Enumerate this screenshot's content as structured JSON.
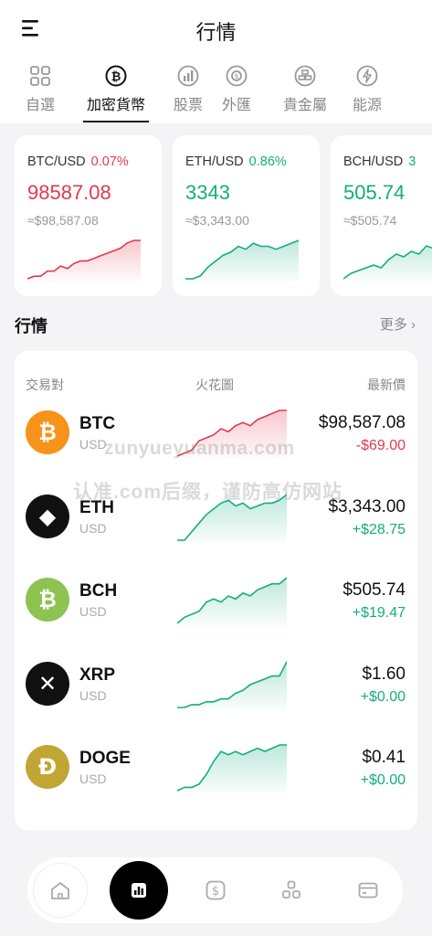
{
  "header": {
    "title": "行情"
  },
  "tabs": [
    {
      "label": "自選",
      "icon": "grid-icon",
      "active": false
    },
    {
      "label": "加密貨幣",
      "icon": "bitcoin-icon",
      "active": true
    },
    {
      "label": "股票",
      "icon": "stock-chart-icon",
      "active": false
    },
    {
      "label": "外匯",
      "icon": "exchange-icon",
      "active": false
    },
    {
      "label": "貴金屬",
      "icon": "gold-icon",
      "active": false
    },
    {
      "label": "能源",
      "icon": "energy-icon",
      "active": false
    }
  ],
  "featured": [
    {
      "pair": "BTC/USD",
      "change_pct": "0.07%",
      "price": "98587.08",
      "approx": "≈$98,587.08",
      "trend": "up-red",
      "sparkline": [
        2,
        3,
        3,
        5,
        5,
        7,
        6,
        8,
        9,
        9,
        10,
        11,
        12,
        13,
        14,
        16,
        17,
        17
      ]
    },
    {
      "pair": "ETH/USD",
      "change_pct": "0.86%",
      "price": "3343",
      "approx": "≈$3,343.00",
      "trend": "up-green",
      "sparkline": [
        1,
        1,
        2,
        5,
        7,
        9,
        10,
        12,
        11,
        13,
        12,
        12,
        11,
        12,
        13,
        14
      ]
    },
    {
      "pair": "BCH/USD",
      "change_pct": "3",
      "price": "505.74",
      "approx": "≈$505.74",
      "trend": "up-green",
      "sparkline": [
        1,
        3,
        4,
        5,
        6,
        5,
        8,
        10,
        9,
        11,
        10,
        13,
        12,
        14,
        14,
        15
      ]
    }
  ],
  "section": {
    "title": "行情",
    "more_label": "更多"
  },
  "table_headers": {
    "pair": "交易對",
    "chart": "火花圖",
    "latest": "最新價"
  },
  "rows": [
    {
      "symbol": "BTC",
      "quote": "USD",
      "price": "$98,587.08",
      "change": "-$69.00",
      "direction": "down",
      "logo_color": "#f7931a",
      "logo_text": "₿",
      "sparkline": [
        2,
        3,
        4,
        7,
        8,
        9,
        11,
        10,
        12,
        13,
        12,
        14,
        15,
        16,
        17,
        17
      ]
    },
    {
      "symbol": "ETH",
      "quote": "USD",
      "price": "$3,343.00",
      "change": "+$28.75",
      "direction": "up",
      "logo_color": "#111111",
      "logo_text": "◆",
      "sparkline": [
        1,
        1,
        4,
        7,
        10,
        12,
        14,
        15,
        13,
        14,
        12,
        13,
        14,
        14,
        15,
        17
      ]
    },
    {
      "symbol": "BCH",
      "quote": "USD",
      "price": "$505.74",
      "change": "+$19.47",
      "direction": "up",
      "logo_color": "#8dc351",
      "logo_text": "₿",
      "sparkline": [
        2,
        4,
        5,
        6,
        9,
        10,
        9,
        11,
        10,
        12,
        11,
        13,
        14,
        15,
        15,
        17
      ]
    },
    {
      "symbol": "XRP",
      "quote": "USD",
      "price": "$1.60",
      "change": "+$0.00",
      "direction": "up",
      "logo_color": "#111111",
      "logo_text": "✕",
      "sparkline": [
        1,
        1,
        2,
        2,
        3,
        3,
        4,
        4,
        6,
        7,
        9,
        10,
        11,
        12,
        12,
        17
      ]
    },
    {
      "symbol": "DOGE",
      "quote": "USD",
      "price": "$0.41",
      "change": "+$0.00",
      "direction": "up",
      "logo_color": "#c2a633",
      "logo_text": "Ð",
      "sparkline": [
        1,
        2,
        2,
        3,
        6,
        10,
        13,
        12,
        13,
        12,
        13,
        14,
        13,
        14,
        15,
        15
      ]
    }
  ],
  "watermark": {
    "line1": "zunyueyuanma.com",
    "line2": "认准.com后缀，谨防高仿网站"
  },
  "bottom_nav": [
    {
      "icon": "home-icon",
      "active": false
    },
    {
      "icon": "market-chart-icon",
      "active": true
    },
    {
      "icon": "dollar-icon",
      "active": false
    },
    {
      "icon": "asset-icon",
      "active": false
    },
    {
      "icon": "wallet-card-icon",
      "active": false
    }
  ],
  "colors": {
    "up": "#14ad7d",
    "down": "#e2394f",
    "accent": "#000000"
  }
}
